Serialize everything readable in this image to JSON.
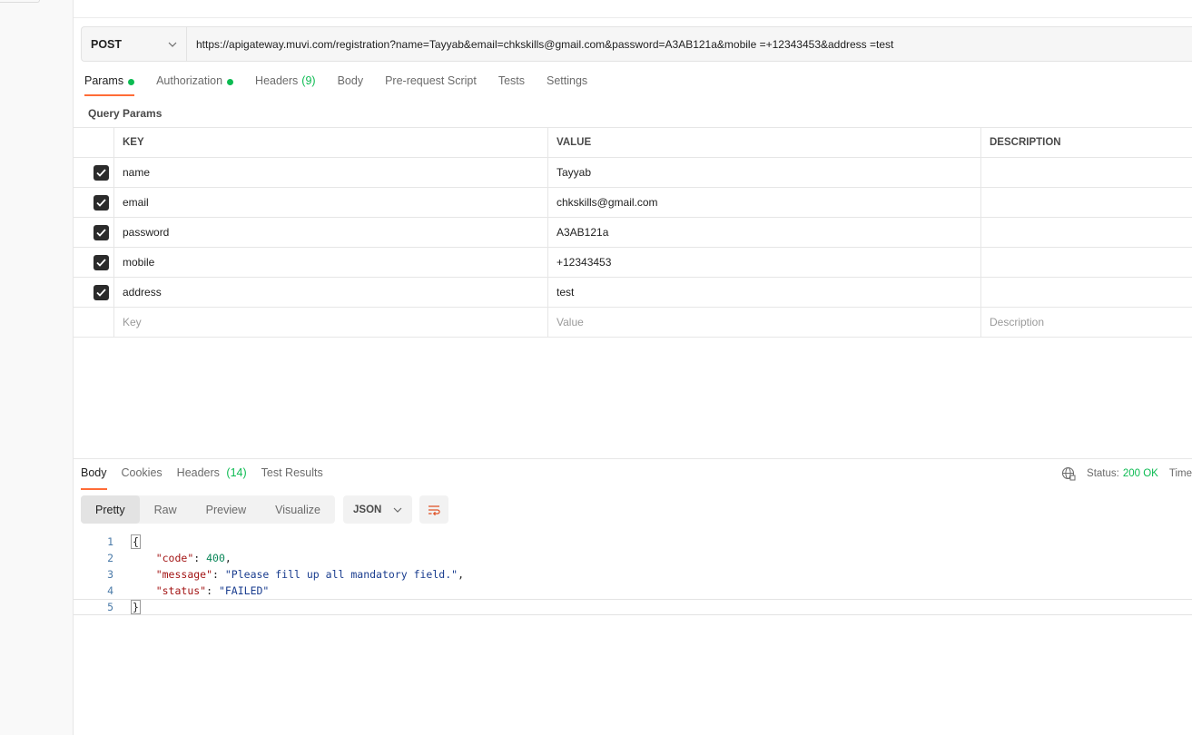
{
  "request": {
    "method": "POST",
    "url": "https://apigateway.muvi.com/registration?name=Tayyab&email=chkskills@gmail.com&password=A3AB121a&mobile =+12343453&address =test"
  },
  "request_tabs": [
    {
      "label": "Params",
      "dot": true
    },
    {
      "label": "Authorization",
      "dot": true
    },
    {
      "label": "Headers",
      "count": "(9)"
    },
    {
      "label": "Body"
    },
    {
      "label": "Pre-request Script"
    },
    {
      "label": "Tests"
    },
    {
      "label": "Settings"
    }
  ],
  "query_params": {
    "title": "Query Params",
    "headers": {
      "key": "KEY",
      "value": "VALUE",
      "description": "DESCRIPTION"
    },
    "rows": [
      {
        "key": "name",
        "value": "Tayyab",
        "checked": true
      },
      {
        "key": "email",
        "value": "chkskills@gmail.com",
        "checked": true
      },
      {
        "key": "password",
        "value": "A3AB121a",
        "checked": true
      },
      {
        "key": "mobile",
        "value": "+12343453",
        "checked": true
      },
      {
        "key": "address",
        "value": "test",
        "checked": true
      }
    ],
    "placeholders": {
      "key": "Key",
      "value": "Value",
      "description": "Description"
    }
  },
  "response_tabs": [
    {
      "label": "Body"
    },
    {
      "label": "Cookies"
    },
    {
      "label": "Headers",
      "count": "(14)"
    },
    {
      "label": "Test Results"
    }
  ],
  "response_status": {
    "label": "Status:",
    "value": "200 OK",
    "time_label": "Time"
  },
  "view_modes": [
    "Pretty",
    "Raw",
    "Preview",
    "Visualize"
  ],
  "format": "JSON",
  "response_body": {
    "line_numbers": [
      "1",
      "2",
      "3",
      "4",
      "5"
    ],
    "open_brace": "{",
    "close_brace": "}",
    "fields": [
      {
        "key": "\"code\"",
        "value": "400",
        "type": "number",
        "trail": ","
      },
      {
        "key": "\"message\"",
        "value": "\"Please fill up all mandatory field.\"",
        "type": "string",
        "trail": ","
      },
      {
        "key": "\"status\"",
        "value": "\"FAILED\"",
        "type": "string",
        "trail": ""
      }
    ]
  },
  "colors": {
    "accent": "#ff6c37",
    "success": "#0cbb52"
  }
}
